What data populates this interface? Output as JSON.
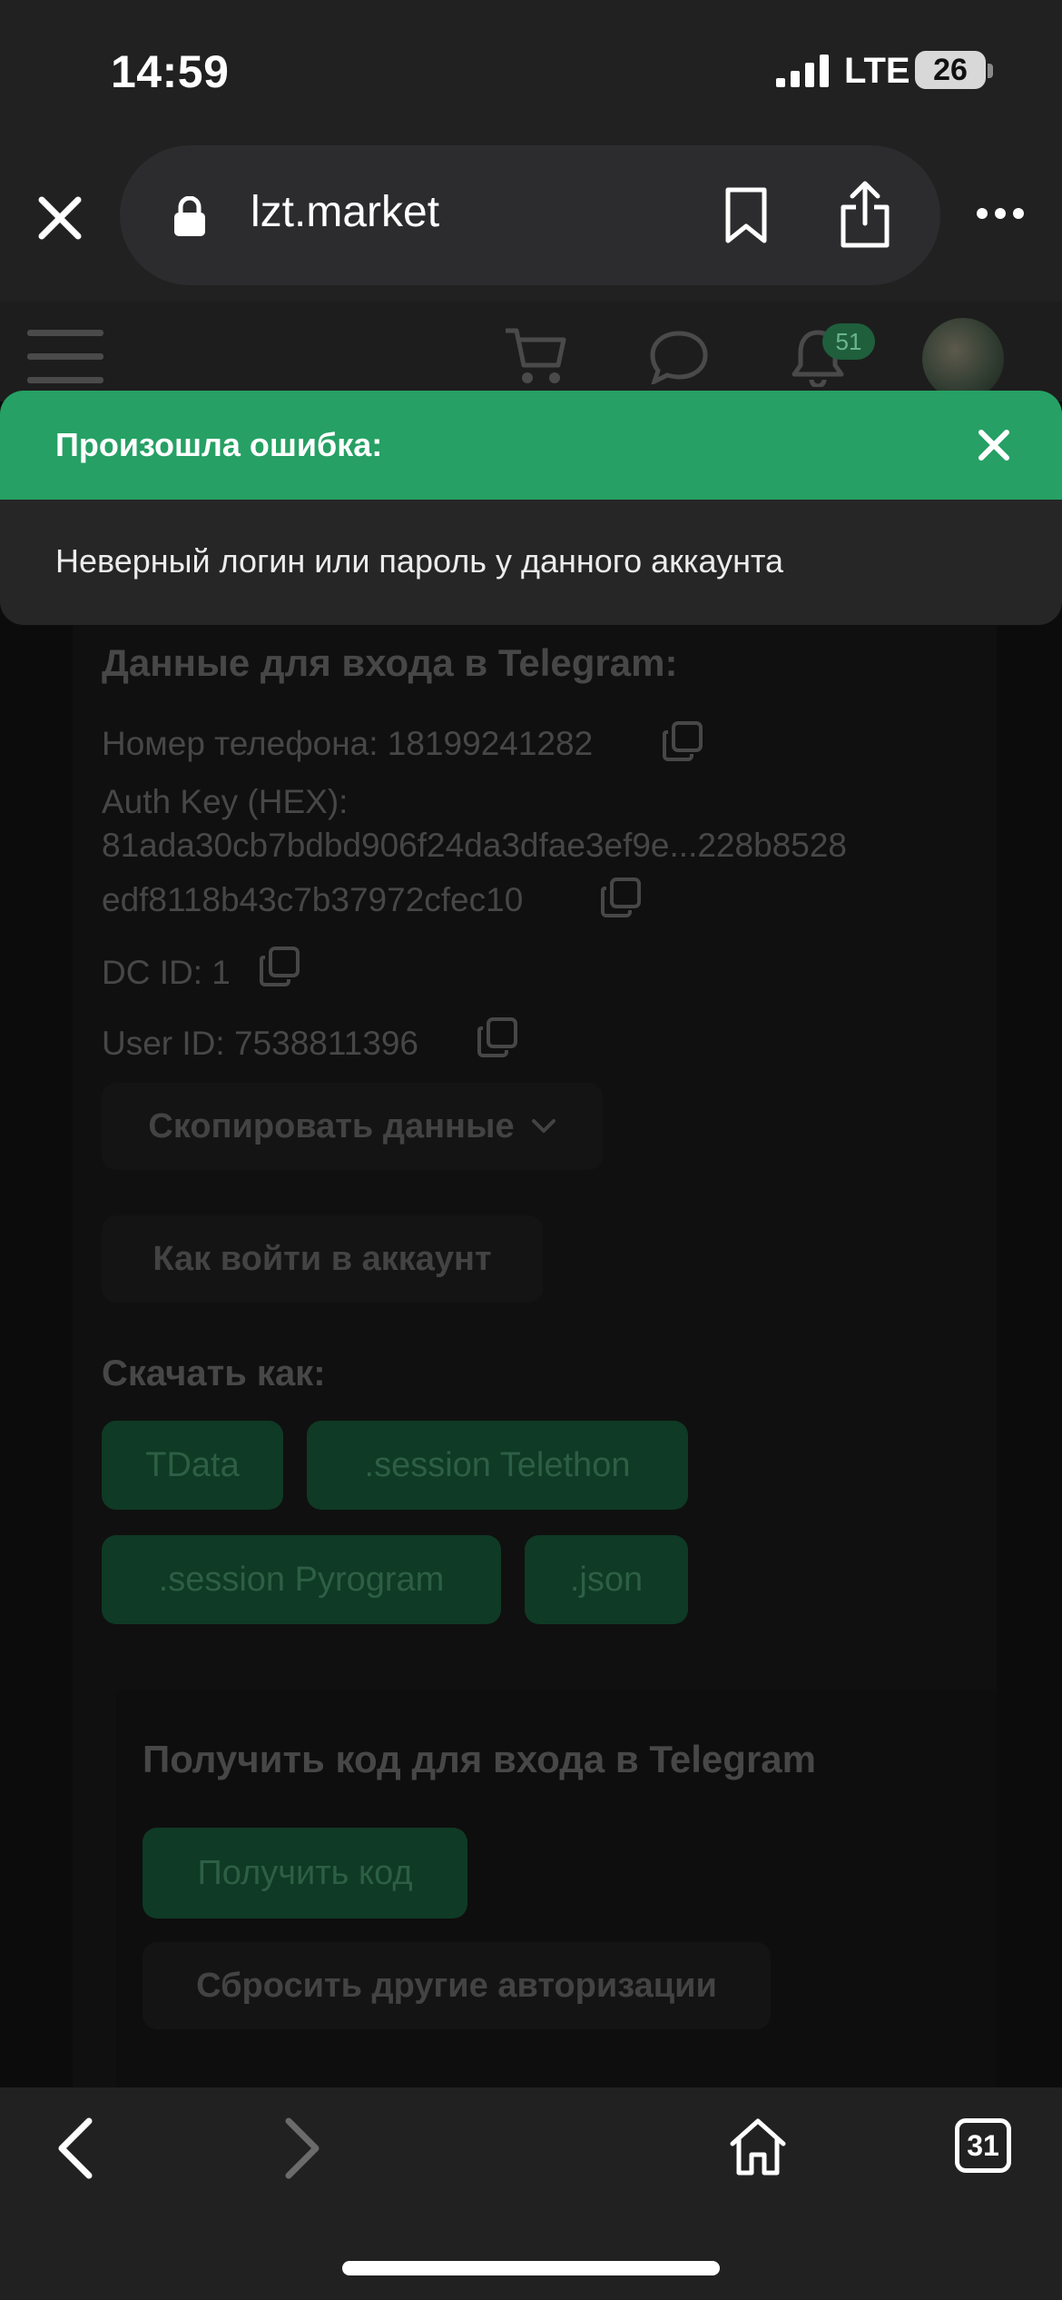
{
  "status_bar": {
    "time": "14:59",
    "network": "LTE",
    "battery": "26"
  },
  "browser": {
    "url": "lzt.market",
    "tabs_count": "31"
  },
  "site_header": {
    "notifications_badge": "51"
  },
  "error": {
    "title": "Произошла ошибка:",
    "message": "Неверный логин или пароль у данного аккаунта"
  },
  "telegram": {
    "heading": "Данные для входа в Telegram:",
    "phone": "Номер телефона: 18199241282",
    "auth_key_label": "Auth Key (HEX):",
    "auth_key_line1": "81ada30cb7bdbd906f24da3dfae3ef9e...228b8528",
    "auth_key_line2": "edf8118b43c7b37972cfec10",
    "dc_id": "DC ID: 1",
    "user_id": "User ID: 7538811396",
    "copy_data_button": "Скопировать данные",
    "how_to_login_button": "Как войти в аккаунт"
  },
  "download": {
    "heading": "Скачать как:",
    "formats": [
      "TData",
      ".session Telethon",
      ".session Pyrogram",
      ".json"
    ]
  },
  "code_section": {
    "heading": "Получить код для входа в Telegram",
    "get_code_button": "Получить код",
    "reset_button": "Сбросить другие авторизации"
  }
}
